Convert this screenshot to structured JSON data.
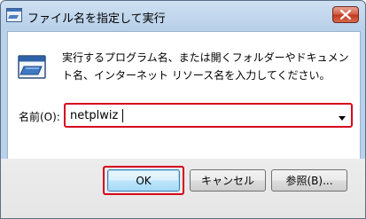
{
  "window": {
    "title": "ファイル名を指定して実行",
    "close_icon": "close-icon"
  },
  "prompt": {
    "description": "実行するプログラム名、または開くフォルダーやドキュメント名、インターネット リソース名を入力してください。",
    "icon": "run-dialog-icon"
  },
  "name_field": {
    "label": "名前(O):",
    "value": "netplwiz",
    "dropdown_icon": "chevron-down-icon"
  },
  "buttons": {
    "ok": "OK",
    "cancel": "キャンセル",
    "browse": "参照(B)..."
  },
  "colors": {
    "highlight": "#d6001c",
    "title_bar": "#b9d1ea",
    "close_button": "#c4361c"
  }
}
